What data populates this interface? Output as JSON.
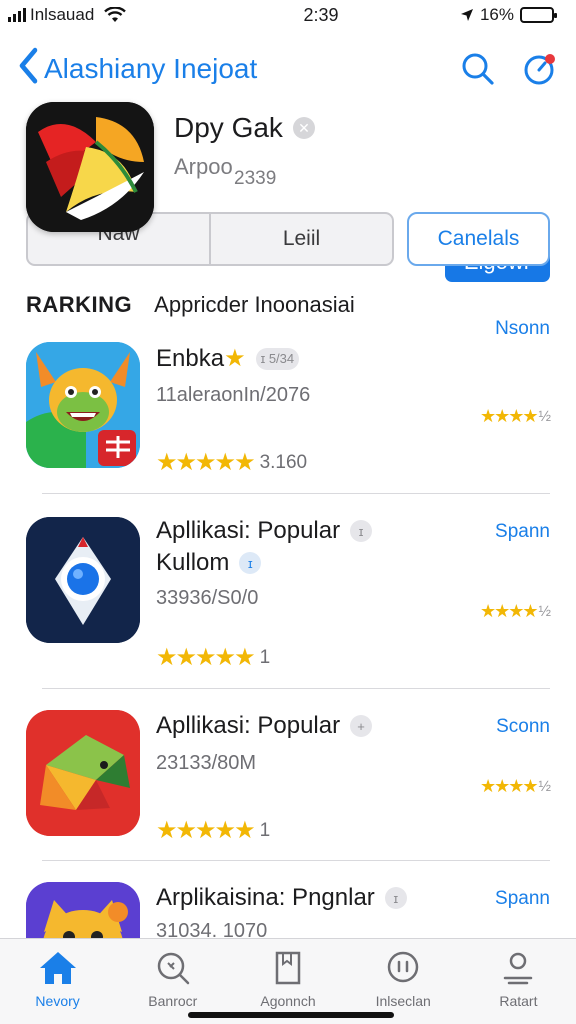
{
  "status_bar": {
    "carrier": "Inlsauad",
    "time": "2:39",
    "battery_text": "16%",
    "battery_level": 0.16
  },
  "nav": {
    "back_icon": "chevron-left-icon",
    "title": "Alashiany Inejoat",
    "icons": [
      "search-icon",
      "notification-icon"
    ]
  },
  "featured": {
    "name": "Dpy Gak",
    "subtitle": "Arpoo",
    "count": "2339",
    "get_label": "Eigowr",
    "segments": [
      "Naw",
      "Leiil"
    ],
    "cancel_label": "Canelals"
  },
  "section": {
    "heading": "RARKING",
    "subheading": "Appricder Inoonasiai",
    "see_all": "Nsonn"
  },
  "apps": [
    {
      "title": "Enbka",
      "badge": "ɪ 5/34",
      "subtitle": "11aleraonIn/2076",
      "link": "",
      "rating_right_stars": "★★★★",
      "rating_right_tail": "½",
      "rating_left_stars": "★★★★★",
      "rating_left_count": "3.160"
    },
    {
      "title": "Apllikasi: Popular",
      "badge": "ɪ",
      "title2": "Kullom",
      "badge2": "ɪ",
      "subtitle": "33936/S0/0",
      "link": "Spann",
      "rating_right_stars": "★★★★",
      "rating_right_tail": "½",
      "rating_left_stars": "★★★★★",
      "rating_left_count": "1"
    },
    {
      "title": "Apllikasi: Popular",
      "badge": "+",
      "subtitle": "23133/80M",
      "link": "Sconn",
      "rating_right_stars": "★★★★",
      "rating_right_tail": "½",
      "rating_left_stars": "★★★★★",
      "rating_left_count": "1"
    },
    {
      "title": "Arplikaisina: Pngnlar",
      "badge": "ɪ",
      "subtitle": "31034. 1070",
      "link": "Spann"
    }
  ],
  "tabs": [
    {
      "label": "Nevory",
      "icon": "home-icon"
    },
    {
      "label": "Banrocr",
      "icon": "search-icon"
    },
    {
      "label": "Agonnch",
      "icon": "bookmark-icon"
    },
    {
      "label": "Inlseclan",
      "icon": "message-icon"
    },
    {
      "label": "Ratart",
      "icon": "profile-icon"
    }
  ],
  "colors": {
    "accent": "#1a7fe8",
    "star": "#f2b705",
    "get_button": "#1778e6"
  }
}
